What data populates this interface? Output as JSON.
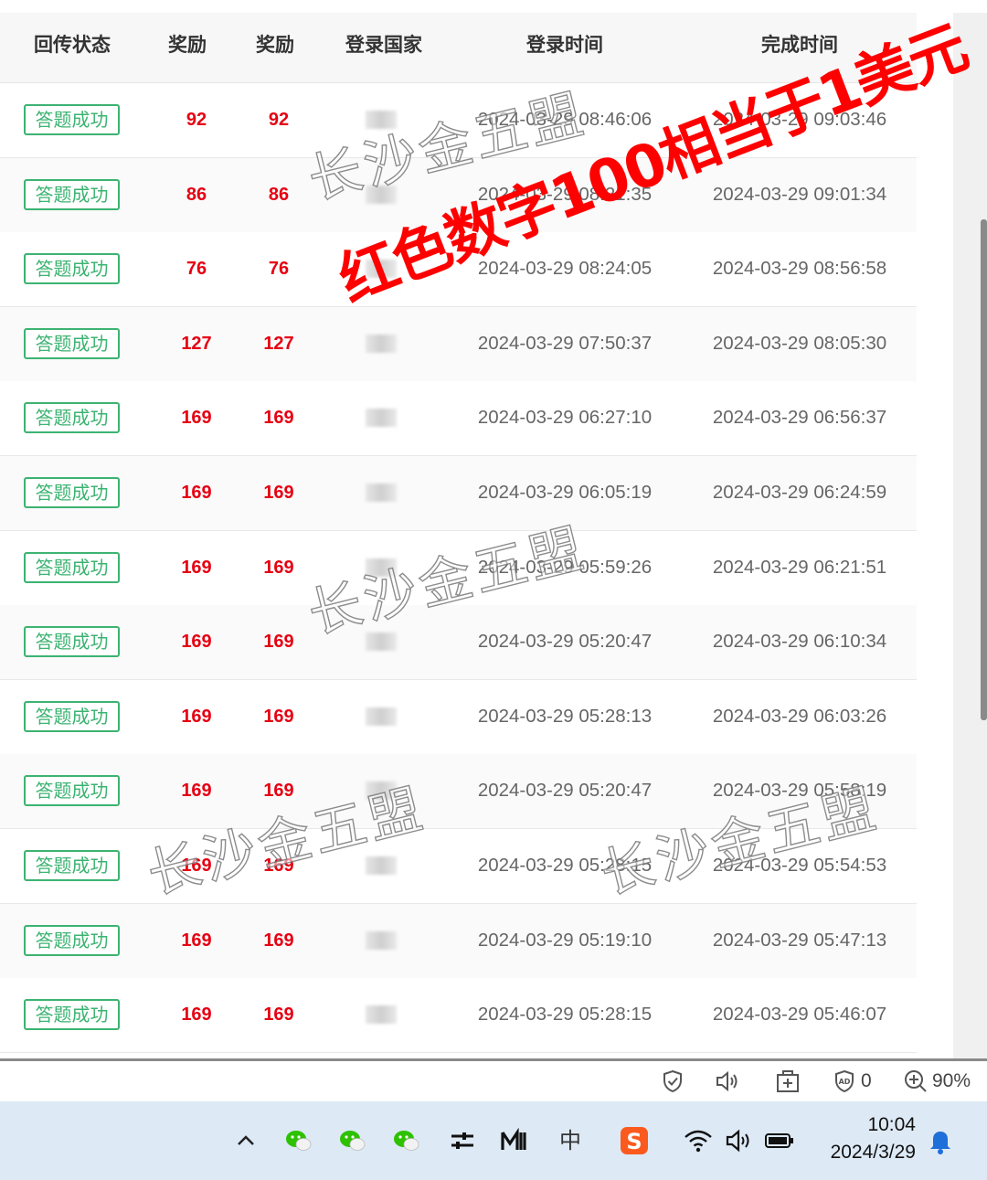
{
  "table": {
    "headers": [
      "回传状态",
      "奖励",
      "奖励",
      "登录国家",
      "登录时间",
      "完成时间"
    ],
    "rows": [
      {
        "status": "答题成功",
        "reward1": "92",
        "reward2": "92",
        "login": "2024-03-29 08:46:06",
        "finish": "2024-03-29 09:03:46"
      },
      {
        "status": "答题成功",
        "reward1": "86",
        "reward2": "86",
        "login": "2024-03-29 08:21:35",
        "finish": "2024-03-29 09:01:34"
      },
      {
        "status": "答题成功",
        "reward1": "76",
        "reward2": "76",
        "login": "2024-03-29 08:24:05",
        "finish": "2024-03-29 08:56:58"
      },
      {
        "status": "答题成功",
        "reward1": "127",
        "reward2": "127",
        "login": "2024-03-29 07:50:37",
        "finish": "2024-03-29 08:05:30"
      },
      {
        "status": "答题成功",
        "reward1": "169",
        "reward2": "169",
        "login": "2024-03-29 06:27:10",
        "finish": "2024-03-29 06:56:37"
      },
      {
        "status": "答题成功",
        "reward1": "169",
        "reward2": "169",
        "login": "2024-03-29 06:05:19",
        "finish": "2024-03-29 06:24:59"
      },
      {
        "status": "答题成功",
        "reward1": "169",
        "reward2": "169",
        "login": "2024-03-29 05:59:26",
        "finish": "2024-03-29 06:21:51"
      },
      {
        "status": "答题成功",
        "reward1": "169",
        "reward2": "169",
        "login": "2024-03-29 05:20:47",
        "finish": "2024-03-29 06:10:34"
      },
      {
        "status": "答题成功",
        "reward1": "169",
        "reward2": "169",
        "login": "2024-03-29 05:28:13",
        "finish": "2024-03-29 06:03:26"
      },
      {
        "status": "答题成功",
        "reward1": "169",
        "reward2": "169",
        "login": "2024-03-29 05:20:47",
        "finish": "2024-03-29 05:58:19"
      },
      {
        "status": "答题成功",
        "reward1": "169",
        "reward2": "169",
        "login": "2024-03-29 05:28:15",
        "finish": "2024-03-29 05:54:53"
      },
      {
        "status": "答题成功",
        "reward1": "169",
        "reward2": "169",
        "login": "2024-03-29 05:19:10",
        "finish": "2024-03-29 05:47:13"
      },
      {
        "status": "答题成功",
        "reward1": "169",
        "reward2": "169",
        "login": "2024-03-29 05:28:15",
        "finish": "2024-03-29 05:46:07"
      }
    ]
  },
  "overlay": {
    "watermark_text": "长沙金五盟",
    "note": "红色数字100相当于1美元"
  },
  "statusbar": {
    "ad_count": "0",
    "zoom": "90%",
    "icons": [
      "shield-check-icon",
      "read-aloud-icon",
      "add-tab-icon",
      "ad-block-icon",
      "zoom-in-icon"
    ]
  },
  "taskbar": {
    "time": "10:04",
    "date": "2024/3/29",
    "ime_label": "中",
    "icons": [
      "chevron-up-icon",
      "wechat-icon",
      "wechat-icon",
      "wechat-icon",
      "settings-sliders-icon",
      "app-m-icon",
      "ime-icon",
      "sogou-input-icon",
      "wifi-icon",
      "volume-icon",
      "battery-icon",
      "notification-bell-icon"
    ]
  },
  "colors": {
    "reward": "#e60012",
    "status_badge": "#3cb371",
    "note": "#ff0000",
    "taskbar": "#dde9f5"
  }
}
